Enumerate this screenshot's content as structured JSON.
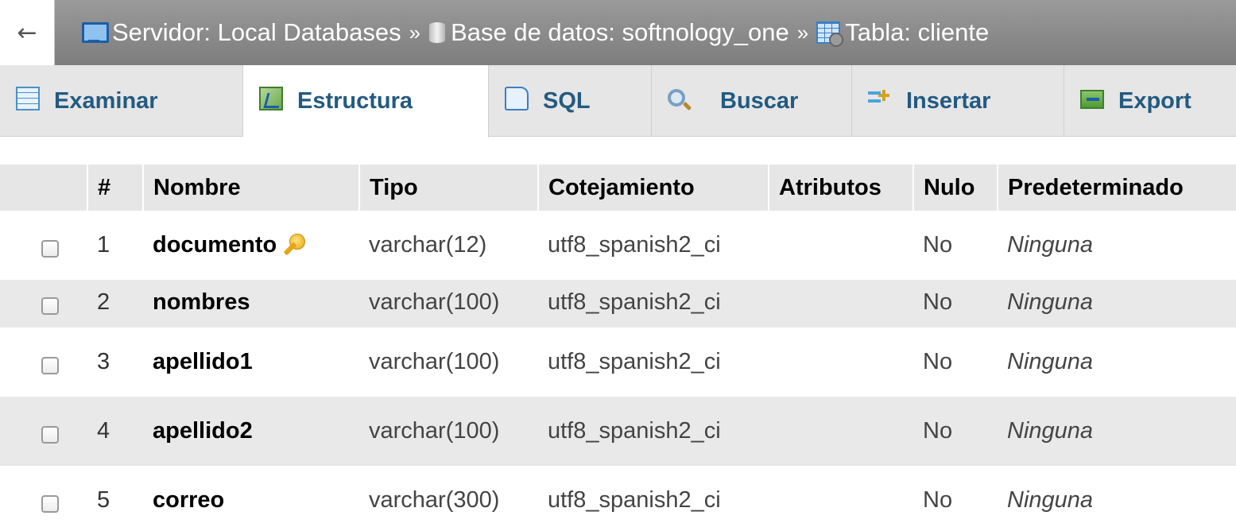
{
  "breadcrumb": {
    "back": "←",
    "server": "Servidor: Local Databases",
    "database": "Base de datos: softnology_one",
    "table": "Tabla: cliente",
    "separator": "»"
  },
  "tabs": [
    {
      "label": "Examinar",
      "icon": "browse-icon"
    },
    {
      "label": "Estructura",
      "icon": "structure-icon",
      "active": true
    },
    {
      "label": "SQL",
      "icon": "sql-icon"
    },
    {
      "label": "Buscar",
      "icon": "search-icon"
    },
    {
      "label": "Insertar",
      "icon": "insert-icon"
    },
    {
      "label": "Export",
      "icon": "export-icon"
    }
  ],
  "columns_header": {
    "num": "#",
    "name": "Nombre",
    "type": "Tipo",
    "collation": "Cotejamiento",
    "attributes": "Atributos",
    "null": "Nulo",
    "default": "Predeterminado"
  },
  "rows": [
    {
      "num": "1",
      "name": "documento",
      "type": "varchar(12)",
      "collation": "utf8_spanish2_ci",
      "attributes": "",
      "null": "No",
      "default": "Ninguna",
      "primary_key": true
    },
    {
      "num": "2",
      "name": "nombres",
      "type": "varchar(100)",
      "collation": "utf8_spanish2_ci",
      "attributes": "",
      "null": "No",
      "default": "Ninguna"
    },
    {
      "num": "3",
      "name": "apellido1",
      "type": "varchar(100)",
      "collation": "utf8_spanish2_ci",
      "attributes": "",
      "null": "No",
      "default": "Ninguna"
    },
    {
      "num": "4",
      "name": "apellido2",
      "type": "varchar(100)",
      "collation": "utf8_spanish2_ci",
      "attributes": "",
      "null": "No",
      "default": "Ninguna"
    },
    {
      "num": "5",
      "name": "correo",
      "type": "varchar(300)",
      "collation": "utf8_spanish2_ci",
      "attributes": "",
      "null": "No",
      "default": "Ninguna"
    }
  ],
  "colors": {
    "tab_text": "#235a81",
    "topbar": "#8a8a8a",
    "header_bg": "#e6e6e6",
    "even_row": "#e9e9e9"
  }
}
